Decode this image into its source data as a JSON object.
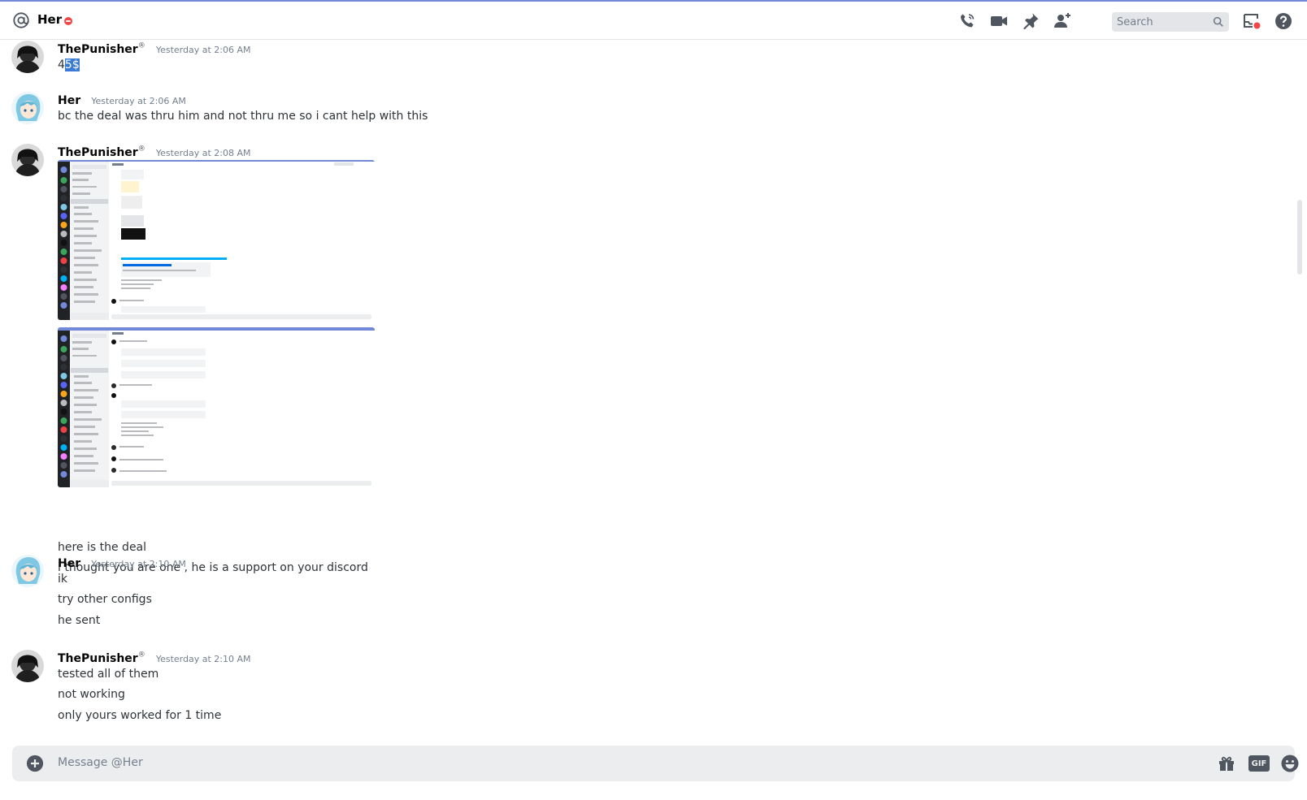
{
  "header": {
    "title": "Her",
    "search_placeholder": "Search"
  },
  "messages": [
    {
      "author": "ThePunisher",
      "reg": "®",
      "timestamp": "Yesterday at 2:06 AM",
      "text_pre": "4",
      "text_sel": "5$"
    },
    {
      "author": "Her",
      "timestamp": "Yesterday at 2:06 AM",
      "lines": [
        "bc the deal was thru him and not thru me so i cant help with this"
      ]
    },
    {
      "author": "ThePunisher",
      "reg": "®",
      "timestamp": "Yesterday at 2:08 AM",
      "lines": [
        "here is the deal",
        "i thought you are one , he is a support on your discord"
      ]
    },
    {
      "author": "Her",
      "timestamp": "Yesterday at 2:10 AM",
      "lines": [
        "ik",
        "try other configs",
        "he sent"
      ]
    },
    {
      "author": "ThePunisher",
      "reg": "®",
      "timestamp": "Yesterday at 2:10 AM",
      "lines": [
        "tested all of them",
        "not working",
        "only yours worked for 1 time"
      ]
    }
  ],
  "composer": {
    "placeholder": "Message @Her",
    "gif_label": "GIF"
  },
  "colors": {
    "accent": "#7289da",
    "dnd": "#f04747",
    "selection": "#3a7bd5"
  },
  "icons": [
    "at-icon",
    "call-icon",
    "video-icon",
    "pin-icon",
    "add-friend-icon",
    "search-icon",
    "inbox-icon",
    "help-icon",
    "add-attachment-icon",
    "gift-icon",
    "gif-icon",
    "emoji-icon"
  ]
}
